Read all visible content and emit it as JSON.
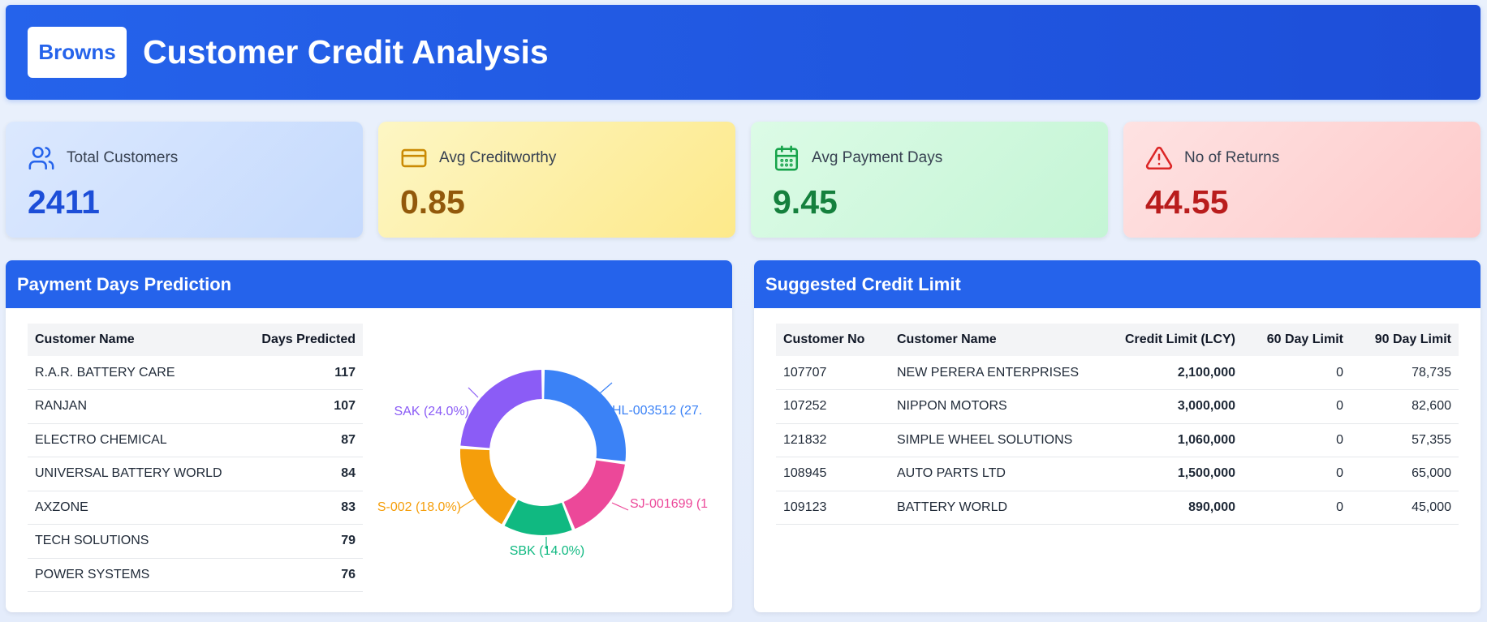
{
  "header": {
    "brand": "Browns",
    "title": "Customer Credit Analysis"
  },
  "kpis": [
    {
      "label": "Total Customers",
      "value": "2411",
      "icon": "users-icon",
      "color": "#1d4ed8"
    },
    {
      "label": "Avg Creditworthy",
      "value": "0.85",
      "icon": "credit-card-icon",
      "color": "#92590b"
    },
    {
      "label": "Avg Payment Days",
      "value": "9.45",
      "icon": "calendar-icon",
      "color": "#15803d"
    },
    {
      "label": "No of Returns",
      "value": "44.55",
      "icon": "alert-triangle-icon",
      "color": "#b91c1c"
    }
  ],
  "payment_days": {
    "title": "Payment Days Prediction",
    "columns": [
      "Customer Name",
      "Days Predicted"
    ],
    "rows": [
      [
        "R.A.R. BATTERY CARE",
        "117"
      ],
      [
        "RANJAN",
        "107"
      ],
      [
        "ELECTRO CHEMICAL",
        "87"
      ],
      [
        "UNIVERSAL BATTERY WORLD",
        "84"
      ],
      [
        "AXZONE",
        "83"
      ],
      [
        "TECH SOLUTIONS",
        "79"
      ],
      [
        "POWER SYSTEMS",
        "76"
      ]
    ]
  },
  "credit_limit": {
    "title": "Suggested Credit Limit",
    "columns": [
      "Customer No",
      "Customer Name",
      "Credit Limit (LCY)",
      "60 Day Limit",
      "90 Day Limit"
    ],
    "rows": [
      [
        "107707",
        "NEW PERERA ENTERPRISES",
        "2,100,000",
        "0",
        "78,735"
      ],
      [
        "107252",
        "NIPPON MOTORS",
        "3,000,000",
        "0",
        "82,600"
      ],
      [
        "121832",
        "SIMPLE WHEEL SOLUTIONS",
        "1,060,000",
        "0",
        "57,355"
      ],
      [
        "108945",
        "AUTO PARTS LTD",
        "1,500,000",
        "0",
        "65,000"
      ],
      [
        "109123",
        "BATTERY WORLD",
        "890,000",
        "0",
        "45,000"
      ]
    ]
  },
  "chart_data": {
    "type": "pie",
    "title": "",
    "slices": [
      {
        "label": "HL-003512 (27.",
        "value": 27.0,
        "color": "#3b82f6"
      },
      {
        "label": "SJ-001699 (1",
        "value": 17.0,
        "color": "#ec4899"
      },
      {
        "label": "SBK (14.0%)",
        "value": 14.0,
        "color": "#10b981"
      },
      {
        "label": "S-002 (18.0%)",
        "value": 18.0,
        "color": "#f59e0b"
      },
      {
        "label": "SAK (24.0%)",
        "value": 24.0,
        "color": "#8b5cf6"
      }
    ]
  }
}
